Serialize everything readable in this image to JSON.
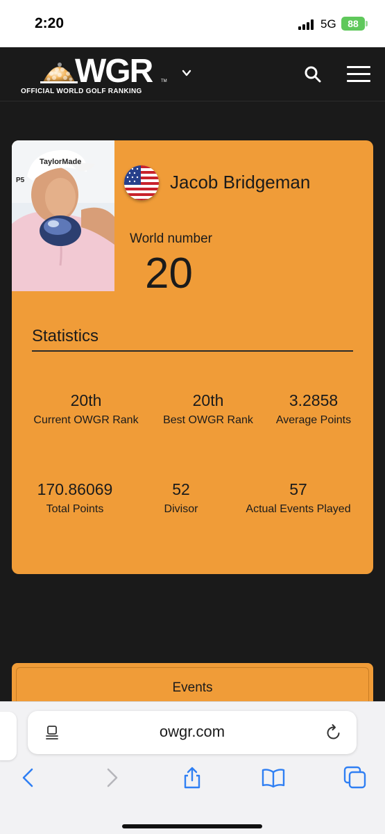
{
  "status_bar": {
    "time": "2:20",
    "network": "5G",
    "battery": "88"
  },
  "header": {
    "logo_text": "WGR",
    "logo_subtitle": "OFFICIAL WORLD GOLF RANKING",
    "logo_tm": "TM"
  },
  "player": {
    "name": "Jacob Bridgeman",
    "country_flag": "us-flag-icon",
    "world_number_label": "World number",
    "world_number": "20"
  },
  "statistics": {
    "title": "Statistics",
    "items": [
      {
        "value": "20th",
        "label": "Current OWGR Rank"
      },
      {
        "value": "20th",
        "label": "Best OWGR Rank"
      },
      {
        "value": "3.2858",
        "label": "Average Points"
      },
      {
        "value": "170.86069",
        "label": "Total Points"
      },
      {
        "value": "52",
        "label": "Divisor"
      },
      {
        "value": "57",
        "label": "Actual Events Played"
      }
    ]
  },
  "events_button": {
    "label": "Events"
  },
  "browser": {
    "url": "owgr.com"
  },
  "colors": {
    "accent": "#f09c38",
    "background": "#1a1a1a",
    "ios_link": "#2f7ff3",
    "battery": "#5fc85b"
  }
}
